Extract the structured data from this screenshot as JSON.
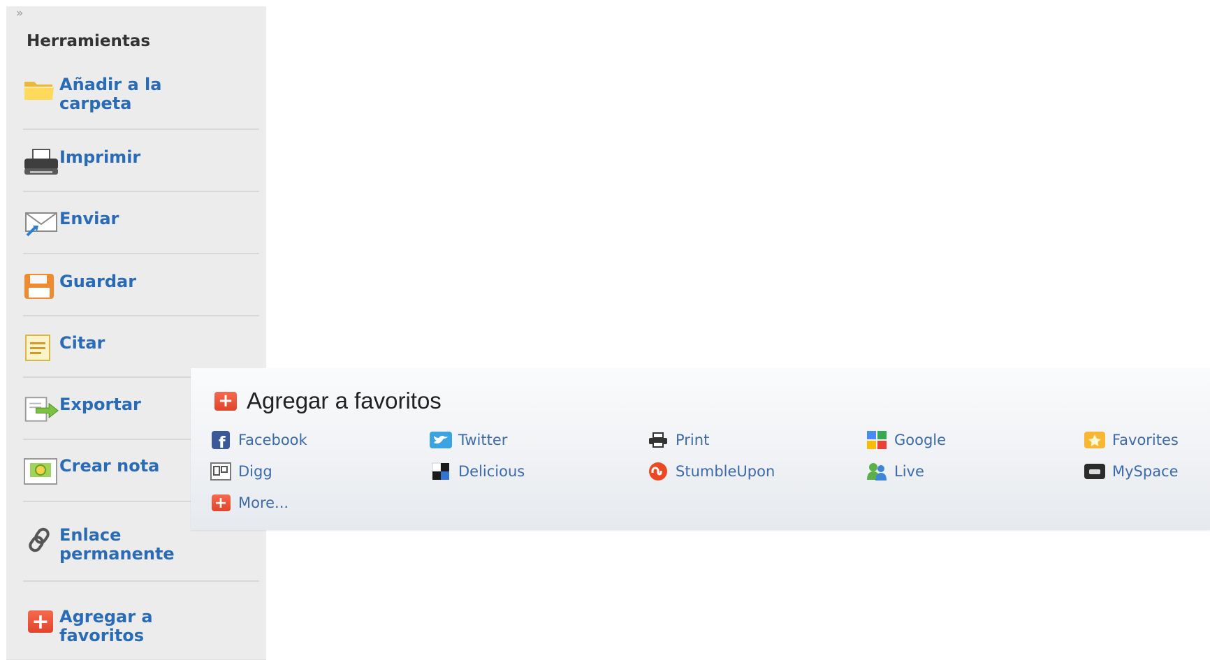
{
  "sidebar": {
    "collapse_glyph": "»",
    "title": "Herramientas",
    "items": [
      {
        "label_line1": "Añadir a la",
        "label_line2": "carpeta",
        "icon": "folder-icon"
      },
      {
        "label_line1": "Imprimir",
        "label_line2": "",
        "icon": "printer-icon"
      },
      {
        "label_line1": "Enviar",
        "label_line2": "",
        "icon": "email-icon"
      },
      {
        "label_line1": "Guardar",
        "label_line2": "",
        "icon": "save-icon"
      },
      {
        "label_line1": "Citar",
        "label_line2": "",
        "icon": "cite-icon"
      },
      {
        "label_line1": "Exportar",
        "label_line2": "",
        "icon": "export-icon"
      },
      {
        "label_line1": "Crear nota",
        "label_line2": "",
        "icon": "note-icon"
      },
      {
        "label_line1": "Enlace",
        "label_line2": "permanente",
        "icon": "link-icon"
      },
      {
        "label_line1": "Agregar a",
        "label_line2": "favoritos",
        "icon": "add-plus-icon"
      }
    ]
  },
  "popup": {
    "title": "Agregar a favoritos",
    "links": [
      {
        "label": "Facebook",
        "icon": "facebook-icon"
      },
      {
        "label": "Twitter",
        "icon": "twitter-icon"
      },
      {
        "label": "Print",
        "icon": "printer-icon"
      },
      {
        "label": "Google",
        "icon": "google-icon"
      },
      {
        "label": "Favorites",
        "icon": "star-icon"
      },
      {
        "label": "Digg",
        "icon": "digg-icon"
      },
      {
        "label": "Delicious",
        "icon": "delicious-icon"
      },
      {
        "label": "StumbleUpon",
        "icon": "stumbleupon-icon"
      },
      {
        "label": "Live",
        "icon": "live-icon"
      },
      {
        "label": "MySpace",
        "icon": "myspace-icon"
      },
      {
        "label": "More...",
        "icon": "more-plus-icon"
      }
    ]
  },
  "colors": {
    "link_blue": "#2a6bb5",
    "sidebar_bg": "#ececec",
    "plus_red": "#e84c30"
  }
}
